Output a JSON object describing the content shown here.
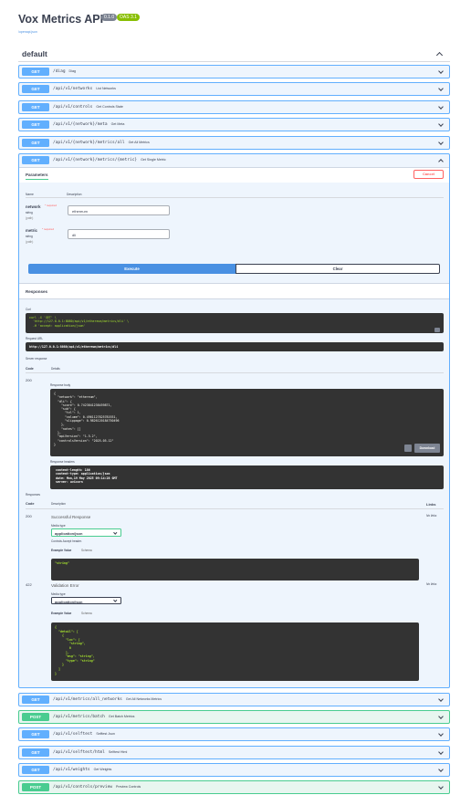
{
  "header": {
    "title": "Vox Metrics API",
    "version_badge": "0.1.0",
    "oas_badge": "OAS 3.1",
    "spec_link": "/openapi.json"
  },
  "tag": {
    "name": "default"
  },
  "operations_top": [
    {
      "method": "GET",
      "path": "/diag",
      "summary": "Diag"
    },
    {
      "method": "GET",
      "path": "/api/v1/networks",
      "summary": "List Networks"
    },
    {
      "method": "GET",
      "path": "/api/v1/controls",
      "summary": "Get Controls State"
    },
    {
      "method": "GET",
      "path": "/api/v1/{network}/meta",
      "summary": "Get Meta"
    },
    {
      "method": "GET",
      "path": "/api/v1/{network}/metrics/all",
      "summary": "Get All Metrics"
    }
  ],
  "expanded": {
    "method": "GET",
    "path": "/api/v1/{network}/metrics/{metric}",
    "summary": "Get Single Metric",
    "parameters_tab": "Parameters",
    "cancel_label": "Cancel",
    "col_name": "Name",
    "col_description": "Description",
    "params": [
      {
        "name": "network",
        "required": "* required",
        "type": "string",
        "in": "(path)",
        "value": "ethereum"
      },
      {
        "name": "metric",
        "required": "* required",
        "type": "string",
        "in": "(path)",
        "value": "dli"
      }
    ],
    "execute_label": "Execute",
    "clear_label": "Clear",
    "responses_title": "Responses",
    "curl_label": "Curl",
    "curl_text": "curl -X 'GET' \\\n  'http://127.0.0.1:8080/api/v1/ethereum/metrics/dli' \\\n  -H 'accept: application/json'",
    "request_url_label": "Request URL",
    "request_url": "http://127.0.0.1:8080/api/v1/ethereum/metrics/dli",
    "server_response_label": "Server response",
    "code_label": "Code",
    "details_label": "Details",
    "server_code": "200",
    "response_body_label": "Response body",
    "response_body": "{\n  \"network\": \"ethereum\",\n  \"dli\": {\n    \"score\": 0.7423841238459871,\n    \"sub\": {\n      \"tvl\": 1,\n      \"volume\": 0.4961127825781931,\n      \"slippage\": 0.9826120184750496\n    },\n    \"notes\": []\n  },\n  \"apiVersion\": \"1.5.2\",\n  \"controlsVersion\": \"2025-05-12\"\n}",
    "download_label": "Download",
    "response_headers_label": "Response headers",
    "response_headers": " content-length: 186 \n content-type: application/json \n date: Mon,19 May 2025 09:14:28 GMT \n server: uvicorn ",
    "responses_label": "Responses",
    "col_code": "Code",
    "col_desc": "Description",
    "col_links": "Links",
    "responses": [
      {
        "code": "200",
        "description": "Successful Response",
        "links": "No links",
        "media_label": "Media type",
        "media": "application/json",
        "accept_note": "Controls Accept header.",
        "example_value": "Example Value",
        "schema": "Schema",
        "example": "\"string\""
      },
      {
        "code": "422",
        "description": "Validation Error",
        "links": "No links",
        "media_label": "Media type",
        "media": "application/json",
        "example_value": "Example Value",
        "schema": "Schema",
        "example": "{\n  \"detail\": [\n    {\n      \"loc\": [\n        \"string\",\n        0\n      ],\n      \"msg\": \"string\",\n      \"type\": \"string\"\n    }\n  ]\n}"
      }
    ]
  },
  "operations_bottom": [
    {
      "method": "GET",
      "path": "/api/v1/metrics/all_networks",
      "summary": "Get All Networks Metrics"
    },
    {
      "method": "POST",
      "path": "/api/v1/metrics/batch",
      "summary": "Get Batch Metrics"
    },
    {
      "method": "GET",
      "path": "/api/v1/selftest",
      "summary": "Selftest Json"
    },
    {
      "method": "GET",
      "path": "/api/v1/selftest/html",
      "summary": "Selftest Html"
    },
    {
      "method": "GET",
      "path": "/api/v1/weights",
      "summary": "Get Weights"
    },
    {
      "method": "POST",
      "path": "/api/v1/controls/preview",
      "summary": "Preview Controls"
    }
  ]
}
